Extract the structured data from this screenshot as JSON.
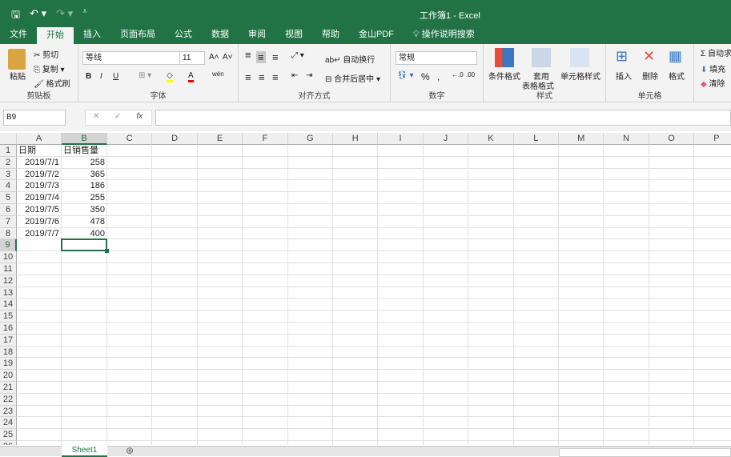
{
  "window": {
    "title": "工作簿1  -  Excel"
  },
  "qat": {
    "save": "🖫",
    "undo": "↶ ▾",
    "redo": "↷ ▾",
    "customize": "⩡"
  },
  "tabs": [
    "文件",
    "开始",
    "插入",
    "页面布局",
    "公式",
    "数据",
    "审阅",
    "视图",
    "帮助",
    "金山PDF"
  ],
  "tell_me": "操作说明搜索",
  "ribbon": {
    "clipboard": {
      "label": "剪贴板",
      "paste": "粘贴",
      "cut": "剪切",
      "copy": "复制",
      "format_painter": "格式刷"
    },
    "font": {
      "label": "字体",
      "name": "等线",
      "size": "11",
      "bold": "B",
      "italic": "I",
      "underline": "U",
      "grow": "A˄",
      "shrink": "A˅",
      "wen": "wén"
    },
    "alignment": {
      "label": "对齐方式",
      "wrap": "自动换行",
      "merge": "合并后居中"
    },
    "number": {
      "label": "数字",
      "format": "常规",
      "percent": "%",
      "comma": ","
    },
    "styles": {
      "label": "样式",
      "cond": "条件格式",
      "table1": "套用",
      "table2": "表格格式",
      "cell": "单元格样式"
    },
    "cells": {
      "label": "单元格",
      "insert": "插入",
      "delete": "删除",
      "format": "格式"
    },
    "editing": {
      "autosum": "自动求",
      "fill": "填充",
      "clear": "清除"
    }
  },
  "formula_bar": {
    "name_box": "B9",
    "cancel": "✕",
    "enter": "✓",
    "fx": "fx",
    "value": ""
  },
  "columns": [
    "A",
    "B",
    "C",
    "D",
    "E",
    "F",
    "G",
    "H",
    "I",
    "J",
    "K",
    "L",
    "M",
    "N",
    "O",
    "P"
  ],
  "rows": [
    [
      "日期",
      "日销售量"
    ],
    [
      "2019/7/1",
      "258"
    ],
    [
      "2019/7/2",
      "365"
    ],
    [
      "2019/7/3",
      "186"
    ],
    [
      "2019/7/4",
      "255"
    ],
    [
      "2019/7/5",
      "350"
    ],
    [
      "2019/7/6",
      "478"
    ],
    [
      "2019/7/7",
      "400"
    ]
  ],
  "row_count": 25,
  "selected_cell": "B9",
  "sheets": [
    "Sheet1"
  ],
  "add_sheet": "⊕",
  "accent": "#217346"
}
